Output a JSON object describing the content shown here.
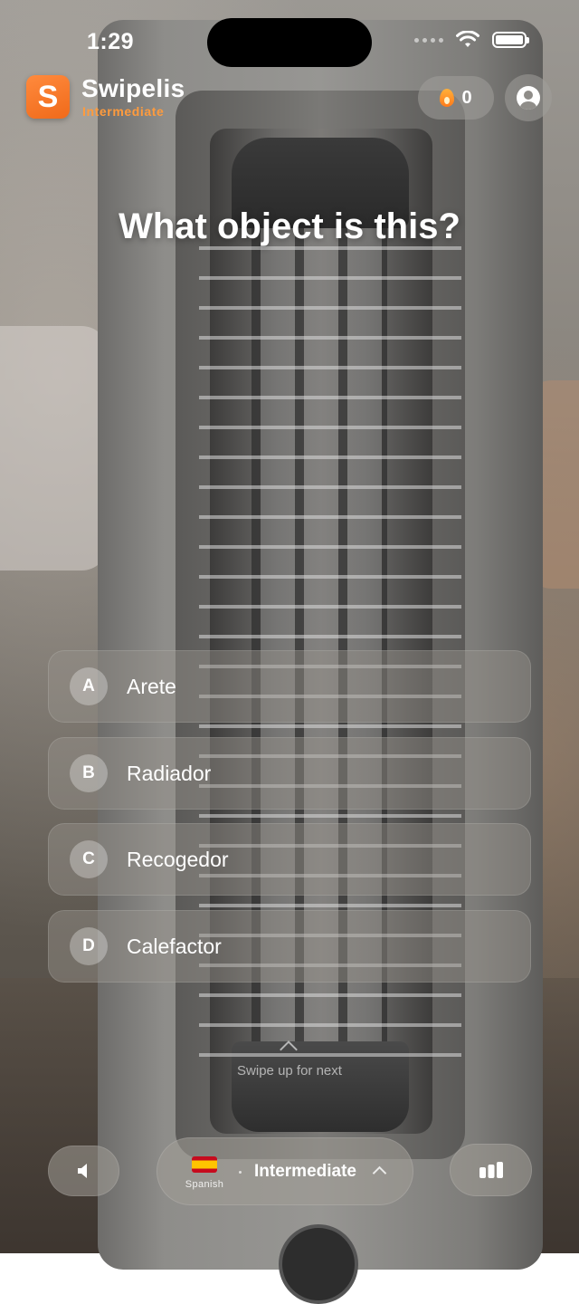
{
  "status_bar": {
    "time": "1:29"
  },
  "header": {
    "app_logo_letter": "S",
    "app_name": "Swipelis",
    "level": "Intermediate",
    "streak_count": "0"
  },
  "question": {
    "text": "What object is this?"
  },
  "options": [
    {
      "letter": "A",
      "text": "Arete"
    },
    {
      "letter": "B",
      "text": "Radiador"
    },
    {
      "letter": "C",
      "text": "Recogedor"
    },
    {
      "letter": "D",
      "text": "Calefactor"
    }
  ],
  "swipe_hint": "Swipe up for next",
  "bottom_bar": {
    "language": "Spanish",
    "level": "Intermediate",
    "icons": [
      "speaker-icon",
      "spain-flag-icon",
      "chevron-up-icon",
      "stats-icon"
    ]
  },
  "colors": {
    "accent": "#ff8a3d",
    "level_text": "#ff9b3d"
  }
}
